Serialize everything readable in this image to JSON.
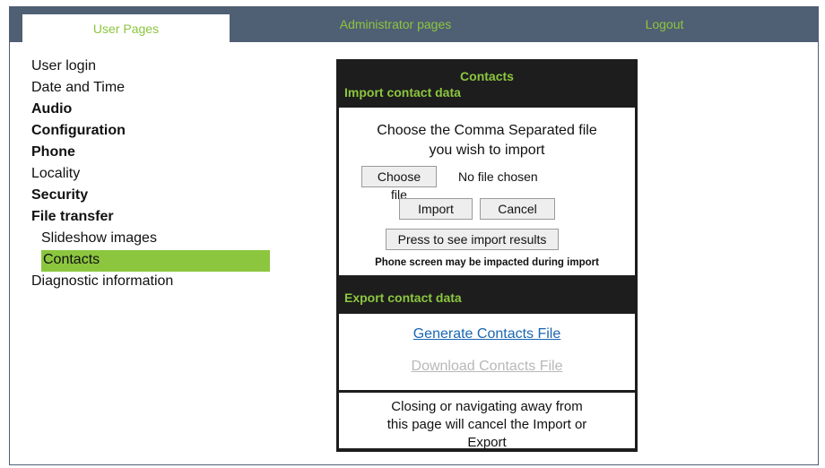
{
  "tabs": {
    "user_pages": "User Pages",
    "admin_pages": "Administrator pages",
    "logout": "Logout"
  },
  "nav": {
    "user_login": "User login",
    "date_time": "Date and Time",
    "audio": "Audio",
    "configuration": "Configuration",
    "phone": "Phone",
    "locality": "Locality",
    "security": "Security",
    "file_transfer": "File transfer",
    "slideshow_images": "Slideshow images",
    "contacts": "Contacts",
    "diagnostic": "Diagnostic information"
  },
  "panel": {
    "title": "Contacts",
    "import_section": "Import contact data",
    "import_prompt_line1": "Choose the Comma Separated file",
    "import_prompt_line2": "you wish to import",
    "choose_file": "Choose file",
    "no_file": "No file chosen",
    "import": "Import",
    "cancel": "Cancel",
    "import_results": "Press to see import results",
    "warning": "Phone screen may be impacted during import",
    "export_section": "Export contact data",
    "generate": "Generate Contacts File",
    "download": "Download Contacts File",
    "notice_line1": "Closing or navigating away  from",
    "notice_line2": "this page will cancel the Import or",
    "notice_line3": "Export"
  },
  "colors": {
    "accent": "#8cc63f",
    "header": "#4f5f74",
    "panel": "#1d1d1d",
    "link": "#1a66b3",
    "disabled_link": "#b8b8b8"
  }
}
